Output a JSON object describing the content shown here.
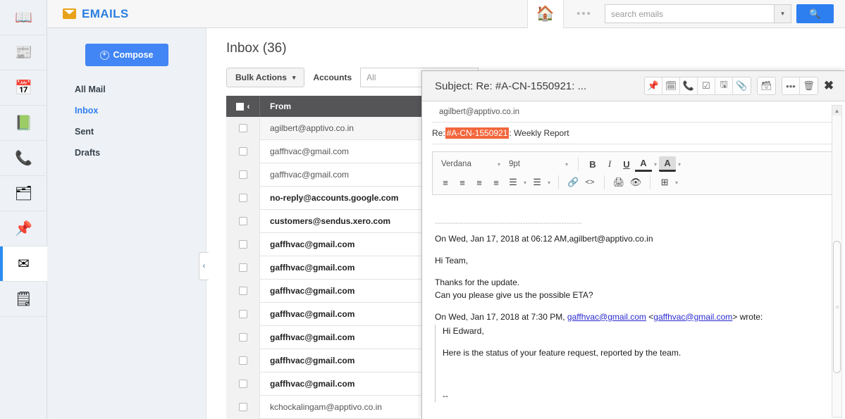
{
  "rail": {
    "items": [
      {
        "name": "contacts-book",
        "glyph": "📖",
        "active": false
      },
      {
        "name": "news",
        "glyph": "📰",
        "active": false
      },
      {
        "name": "calendar",
        "glyph": "📅",
        "active": false
      },
      {
        "name": "tasks",
        "glyph": "📗",
        "active": false
      },
      {
        "name": "calls",
        "glyph": "📞",
        "active": false
      },
      {
        "name": "appointments",
        "glyph": "🗂",
        "active": false
      },
      {
        "name": "pin",
        "glyph": "📌",
        "active": false
      },
      {
        "name": "emails",
        "glyph": "✉",
        "active": true
      },
      {
        "name": "notes",
        "glyph": "🗒",
        "active": false
      }
    ]
  },
  "header": {
    "brand_title": "EMAILS",
    "home_glyph": "🏠",
    "dots_glyph": "•••",
    "search_value": "",
    "search_placeholder": "search emails",
    "search_caret": "▾",
    "search_button_glyph": "🔍"
  },
  "nav": {
    "compose_label": "Compose",
    "compose_plus": "+",
    "items": [
      {
        "label": "All Mail",
        "active": false
      },
      {
        "label": "Inbox",
        "active": true
      },
      {
        "label": "Sent",
        "active": false
      },
      {
        "label": "Drafts",
        "active": false
      }
    ]
  },
  "list": {
    "title": "Inbox (36)",
    "bulk_actions_label": "Bulk Actions",
    "bulk_caret": "▾",
    "accounts_label": "Accounts",
    "accounts_value": "All",
    "accounts_placeholder": "All",
    "sort_arrow": "‹",
    "column_from": "From",
    "rows": [
      {
        "from": "agilbert@apptivo.co.in",
        "unread": false
      },
      {
        "from": "gaffhvac@gmail.com",
        "unread": false
      },
      {
        "from": "gaffhvac@gmail.com",
        "unread": false
      },
      {
        "from": "no-reply@accounts.google.com",
        "unread": true
      },
      {
        "from": "customers@sendus.xero.com",
        "unread": true
      },
      {
        "from": "gaffhvac@gmail.com",
        "unread": true
      },
      {
        "from": "gaffhvac@gmail.com",
        "unread": true
      },
      {
        "from": "gaffhvac@gmail.com",
        "unread": true
      },
      {
        "from": "gaffhvac@gmail.com",
        "unread": true
      },
      {
        "from": "gaffhvac@gmail.com",
        "unread": true
      },
      {
        "from": "gaffhvac@gmail.com",
        "unread": true
      },
      {
        "from": "gaffhvac@gmail.com",
        "unread": true
      },
      {
        "from": "kchockalingam@apptivo.co.in",
        "unread": false
      }
    ],
    "collapse_arrow": "‹"
  },
  "modal": {
    "title": "Subject: Re: #A-CN-1550921: ...",
    "toolbar_icons": [
      {
        "name": "pin-icon",
        "glyph": "📌"
      },
      {
        "name": "calendar-icon",
        "glyph": "🗓"
      },
      {
        "name": "phone-icon",
        "glyph": "📞"
      },
      {
        "name": "task-checkbox-icon",
        "glyph": "☑"
      },
      {
        "name": "document-icon",
        "glyph": "🖫"
      },
      {
        "name": "attachment-icon",
        "glyph": "📎"
      }
    ],
    "move-folder_icon": "🗃",
    "more_icon": "•••",
    "delete_icon": "🗑",
    "close_icon": "✖",
    "to_address": "agilbert@apptivo.co.in",
    "subject_prefix": "Re: ",
    "subject_ticket": "#A-CN-1550921",
    "subject_rest": ": Weekly Report",
    "highlight_color": "#f2663c",
    "editor": {
      "font_family_value": "Verdana",
      "font_size_value": "9pt",
      "caret": "▾",
      "bold": "B",
      "italic": "I",
      "underline": "U",
      "font_color": "A",
      "highlight_color_btn": "A",
      "align_left": "≡",
      "align_center": "≡",
      "align_right": "≡",
      "align_justify": "≡",
      "bullet_list": "☰",
      "numbered_list": "☰",
      "link": "🔗",
      "code": "<>",
      "print": "🖨",
      "preview": "👁",
      "table": "⊞"
    },
    "body": {
      "divider": "---------------------------------------------------------",
      "line_reply_header": "On Wed, Jan 17, 2018 at 06:12 AM,agilbert@apptivo.co.in",
      "greeting": "Hi Team,",
      "thanks_line": "Thanks for the update.",
      "eta_line": "Can you please give us the possible ETA?",
      "wrote_prefix": "On Wed, Jan 17, 2018 at 7:30 PM, ",
      "wrote_email1": "gaffhvac@gmail.com",
      "wrote_mid": " <",
      "wrote_email2": "gaffhvac@gmail.com",
      "wrote_suffix": "> wrote:",
      "quote_greeting": "Hi Edward,",
      "quote_status": "Here is the status of your feature request, reported by the team.",
      "signature_dashes": "--"
    },
    "scrollbar": {
      "up_arrow": "▲",
      "down_arrow": "▼",
      "grip": "≡"
    }
  }
}
